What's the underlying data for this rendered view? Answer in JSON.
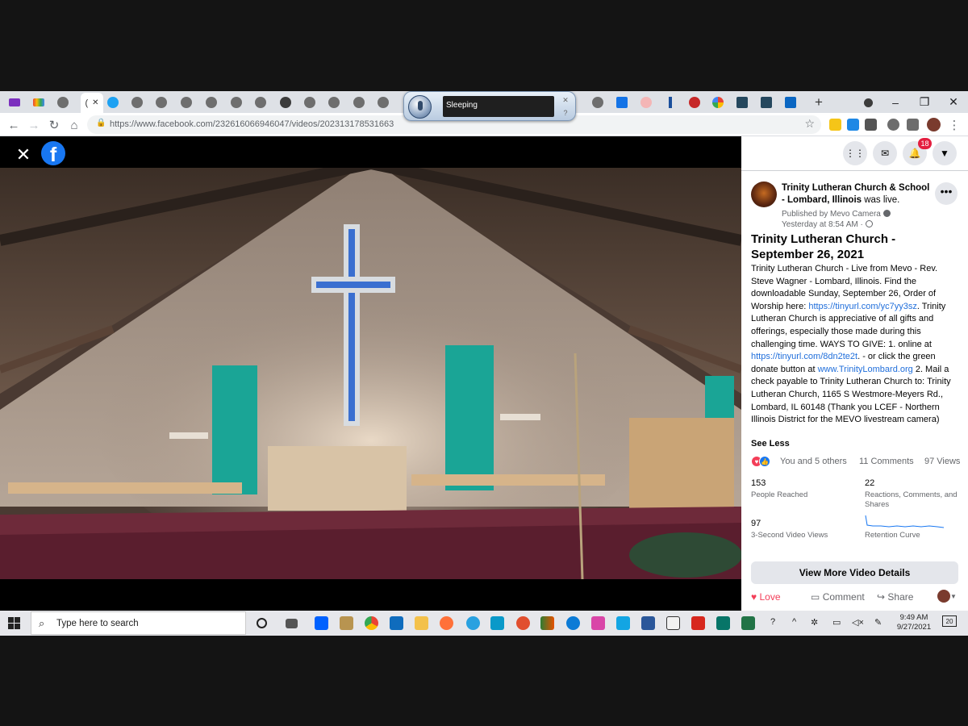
{
  "browser": {
    "url": "https://www.facebook.com/232616066946047/videos/202313178531663",
    "active_tab_label": "(",
    "window_controls": {
      "minimize": "–",
      "restore": "❐",
      "close": "✕"
    },
    "new_tab": "+"
  },
  "voice_recognition": {
    "status": "Sleeping"
  },
  "facebook": {
    "notification_count": "18",
    "post": {
      "page_name": "Trinity Lutheran Church & School - Lombard, Illinois",
      "was_live": "was live.",
      "published_by": "Published by Mevo Camera",
      "time": "Yesterday at 8:54 AM ·",
      "title": "Trinity Lutheran Church - September 26, 2021",
      "body_1": "Trinity Lutheran Church - Live from Mevo - Rev. Steve Wagner - Lombard, Illinois. Find the downloadable Sunday, September 26, Order of Worship here: ",
      "link_1": "https://tinyurl.com/yc7yy3sz",
      "body_2": ". Trinity Lutheran Church is appreciative of all gifts and offerings, especially those made during this challenging time. WAYS TO GIVE: 1. online at ",
      "link_2": "https://tinyurl.com/8dn2te2t",
      "body_3": ". - or click the green donate button at ",
      "link_3": "www.TrinityLombard.org",
      "body_4": " 2. Mail a check payable to Trinity Lutheran Church to: Trinity Lutheran Church, 1165 S Westmore-Meyers Rd., Lombard, IL 60148 (Thank you LCEF - Northern Illinois District for the MEVO livestream camera)",
      "see_less": "See Less",
      "reactions_text": "You and 5 others",
      "comments": "11 Comments",
      "views": "97 Views"
    },
    "stats": {
      "people_reached_value": "153",
      "people_reached_label": "People Reached",
      "reactions_value": "22",
      "reactions_label": "Reactions, Comments, and Shares",
      "video_views_value": "97",
      "video_views_label": "3-Second Video Views",
      "retention_label": "Retention Curve"
    },
    "more_details": "View More Video Details",
    "actions": {
      "love": "Love",
      "comment": "Comment",
      "share": "Share"
    }
  },
  "taskbar": {
    "search_placeholder": "Type here to search",
    "time": "9:49 AM",
    "date": "9/27/2021",
    "notification_count": "20"
  },
  "colors": {
    "facebook_blue": "#1877f2",
    "link_blue": "#216fdb",
    "love_red": "#f33e58",
    "notif_red": "#e41e3f"
  }
}
